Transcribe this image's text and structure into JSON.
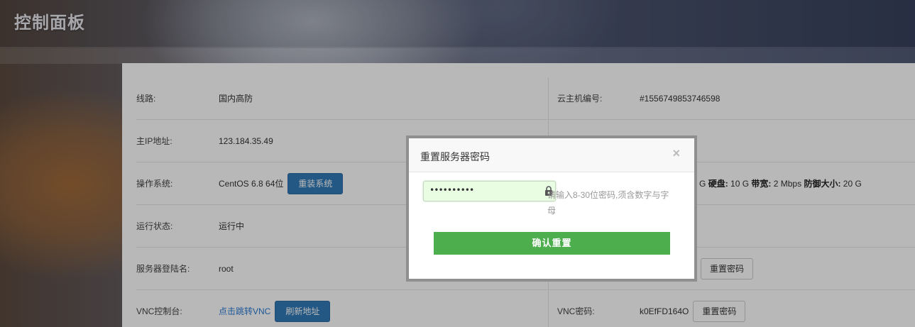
{
  "header": {
    "title": "控制面板"
  },
  "left_rows": [
    {
      "label": "线路:",
      "value": "国内高防"
    },
    {
      "label": "主IP地址:",
      "value": "123.184.35.49"
    },
    {
      "label": "操作系统:",
      "value": "CentOS 6.8 64位",
      "button": "重装系统"
    },
    {
      "label": "运行状态:",
      "value": "运行中"
    },
    {
      "label": "服务器登陆名:",
      "value": "root"
    },
    {
      "label": "VNC控制台:",
      "value": "点击跳转VNC",
      "button": "刷新地址"
    }
  ],
  "right_rows": [
    {
      "label": "云主机编号:",
      "value": "#1556749853746598"
    },
    {
      "label": "",
      "value": ""
    },
    {
      "specs": {
        "mem_value": "2 G",
        "disk_label": "硬盘:",
        "disk_value": "10 G",
        "bw_label": "带宽:",
        "bw_value": "2 Mbps",
        "ddos_label": "防御大小:",
        "ddos_value": "20 G"
      }
    },
    {
      "label": "",
      "value": ""
    },
    {
      "label": "",
      "value": "",
      "button": "重置密码"
    },
    {
      "label": "VNC密码:",
      "value": "k0EfFD164O",
      "button": "重置密码"
    }
  ],
  "modal": {
    "title": "重置服务器密码",
    "close": "×",
    "password_value": "••••••••••",
    "hint_line1": "请输入8-30位密码,须含数字与字",
    "hint_line2": "母",
    "confirm_label": "确认重置"
  },
  "colors": {
    "primary_button": "#337ab7",
    "confirm_button": "#4cae4c",
    "status_running": "#1a9a1a",
    "link": "#2a7ad5"
  }
}
